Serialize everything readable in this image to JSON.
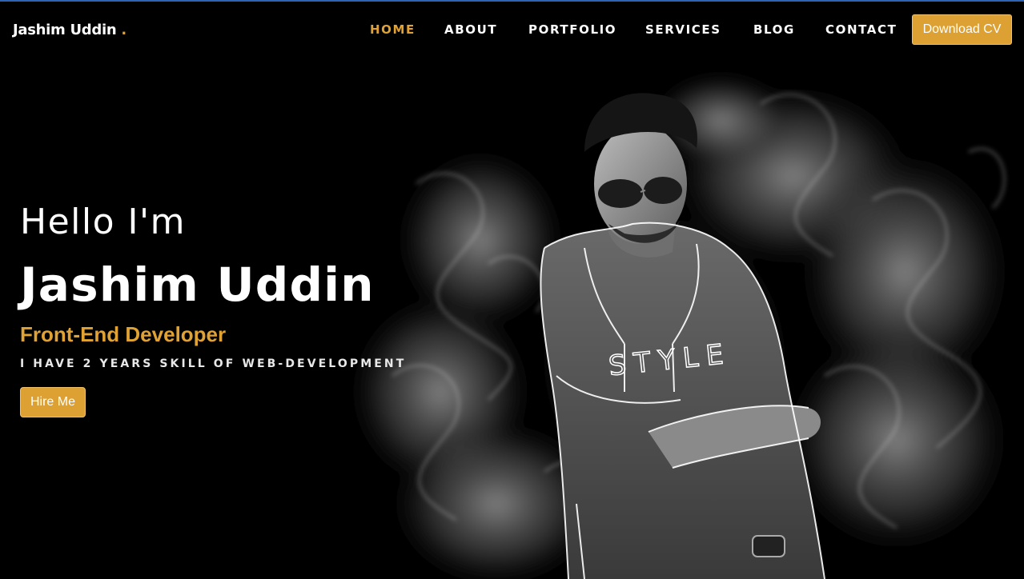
{
  "header": {
    "brand_name": "Jashim Uddin",
    "brand_dot": ".",
    "nav": [
      {
        "label": "HOME",
        "active": true
      },
      {
        "label": "ABOUT",
        "active": false
      },
      {
        "label": "PORTFOLIO",
        "active": false
      },
      {
        "label": "SERVICES",
        "active": false
      },
      {
        "label": "BLOG",
        "active": false
      },
      {
        "label": "CONTACT",
        "active": false
      }
    ],
    "download_label": "Download CV"
  },
  "hero": {
    "greeting": "Hello I'm",
    "name": "Jashim Uddin",
    "role": "Front-End Developer",
    "skill_line": "I HAVE 2 YEARS SKILL OF WEB-DEVELOPMENT",
    "hire_label": "Hire Me",
    "image": {
      "description_icon": "portrait-smoke-icon",
      "shirt_text": "STYLE"
    }
  },
  "colors": {
    "accent": "#dda032",
    "accent_text": "#e0a233",
    "background": "#000000",
    "top_border": "#2f63b8",
    "text": "#ffffff"
  }
}
